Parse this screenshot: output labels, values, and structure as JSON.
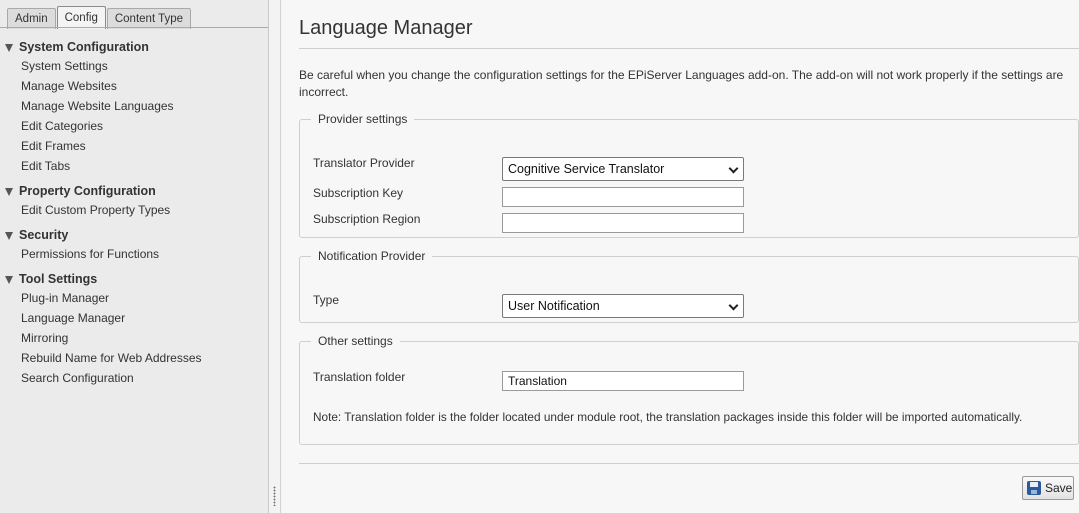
{
  "sidebar": {
    "tabs": [
      {
        "label": "Admin"
      },
      {
        "label": "Config"
      },
      {
        "label": "Content Type"
      }
    ],
    "groups": [
      {
        "title": "System Configuration",
        "items": [
          "System Settings",
          "Manage Websites",
          "Manage Website Languages",
          "Edit Categories",
          "Edit Frames",
          "Edit Tabs"
        ]
      },
      {
        "title": "Property Configuration",
        "items": [
          "Edit Custom Property Types"
        ]
      },
      {
        "title": "Security",
        "items": [
          "Permissions for Functions"
        ]
      },
      {
        "title": "Tool Settings",
        "items": [
          "Plug-in Manager",
          "Language Manager",
          "Mirroring",
          "Rebuild Name for Web Addresses",
          "Search Configuration"
        ]
      }
    ]
  },
  "main": {
    "title": "Language Manager",
    "intro": "Be careful when you change the configuration settings for the EPiServer Languages add-on. The add-on will not work properly if the settings are incorrect.",
    "provider_settings": {
      "legend": "Provider settings",
      "translator_provider_label": "Translator Provider",
      "translator_provider_value": "Cognitive Service Translator",
      "subscription_key_label": "Subscription Key",
      "subscription_key_value": "",
      "subscription_region_label": "Subscription Region",
      "subscription_region_value": ""
    },
    "notification_provider": {
      "legend": "Notification Provider",
      "type_label": "Type",
      "type_value": "User Notification"
    },
    "other_settings": {
      "legend": "Other settings",
      "translation_folder_label": "Translation folder",
      "translation_folder_value": "Translation",
      "note": "Note: Translation folder is the folder located under module root, the translation packages inside this folder will be imported automatically."
    },
    "save_label": "Save"
  },
  "colors": {
    "sidebar_bg": "#ebebeb",
    "main_bg": "#f7f7f7",
    "save_icon": "#2b5a9a"
  }
}
